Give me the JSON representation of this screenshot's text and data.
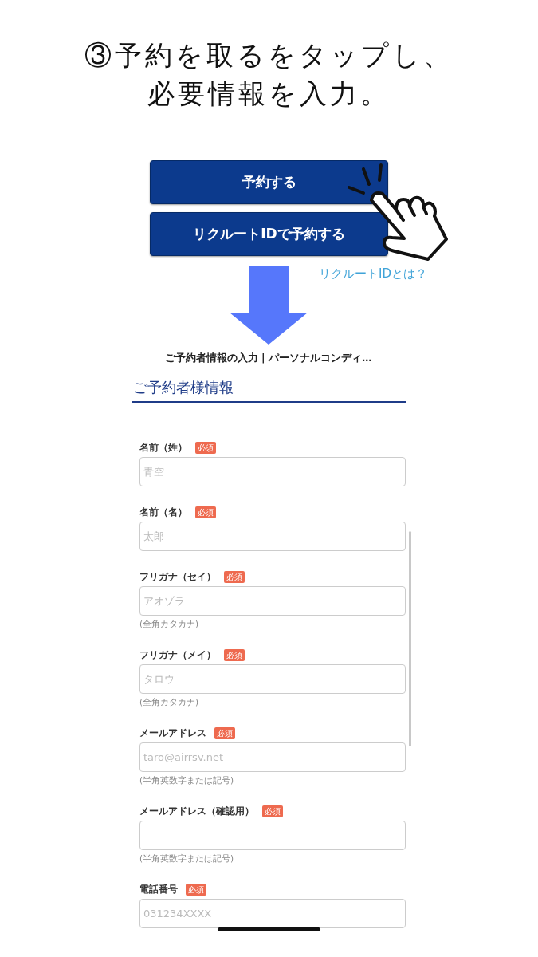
{
  "heading": {
    "lines": [
      "③予約を取るをタップし、",
      "必要情報を入力。"
    ]
  },
  "booking_buttons": [
    {
      "label": "予約する"
    },
    {
      "label": "リクルートIDで予約する"
    }
  ],
  "recruit_id_link": {
    "label": "リクルートIDとは？"
  },
  "form_screenshot": {
    "page_title": "ご予約者情報の入力 | パーソナルコンディ…",
    "section_title": "ご予約者様情報",
    "fields": [
      {
        "label": "名前（姓）",
        "badge": "必須",
        "placeholder": "青空"
      },
      {
        "label": "名前（名）",
        "badge": "必須",
        "placeholder": "太郎"
      },
      {
        "label": "フリガナ（セイ）",
        "badge": "必須",
        "placeholder": "アオゾラ",
        "hint": "(全角カタカナ)"
      },
      {
        "label": "フリガナ（メイ）",
        "badge": "必須",
        "placeholder": "タロウ",
        "hint": "(全角カタカナ)"
      },
      {
        "label": "メールアドレス",
        "badge": "必須",
        "placeholder": "taro@airrsv.net",
        "hint": "(半角英数字または記号)"
      },
      {
        "label": "メールアドレス（確認用）",
        "badge": "必須",
        "hint": "(半角英数字または記号)"
      },
      {
        "label": "電話番号",
        "badge": "必須",
        "placeholder": "031234XXXX"
      }
    ]
  }
}
